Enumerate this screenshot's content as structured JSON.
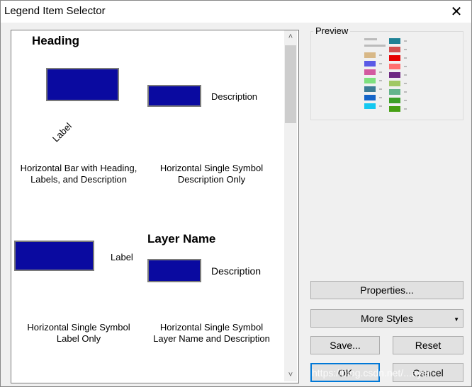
{
  "window": {
    "title": "Legend Item Selector",
    "close_glyph": "✕"
  },
  "gallery": {
    "items": [
      {
        "heading": "Heading",
        "label": "Label",
        "description": "Description",
        "caption1": "Horizontal Bar with Heading,",
        "caption2": "Labels, and Description"
      },
      {
        "description": "Description",
        "caption1": "Horizontal Single Symbol",
        "caption2": "Description Only"
      },
      {
        "label": "Label",
        "caption1": "Horizontal Single Symbol",
        "caption2": "Label Only"
      },
      {
        "layer_name": "Layer Name",
        "description": "Description",
        "caption1": "Horizontal Single Symbol",
        "caption2": "Layer Name and Description"
      }
    ],
    "symbol_color": "#0a0aa0",
    "scroll_up_glyph": "˄",
    "scroll_down_glyph": "˅"
  },
  "preview": {
    "label": "Preview",
    "left_colors": [
      "#d8b887",
      "#5a5ae6",
      "#d35aa0",
      "#7ee07e",
      "#3c7c96",
      "#1464c8",
      "#14c8f0"
    ],
    "right_colors": [
      "#1e8296",
      "#d25050",
      "#e60000",
      "#ff7070",
      "#6e2882",
      "#a0c864",
      "#64b48c",
      "#3ca028",
      "#46a014"
    ]
  },
  "buttons": {
    "properties": "Properties...",
    "more_styles": "More Styles",
    "save": "Save...",
    "reset": "Reset",
    "ok": "OK",
    "cancel": "Cancel"
  },
  "watermark": "https://blog.csdn.net/...ayer"
}
